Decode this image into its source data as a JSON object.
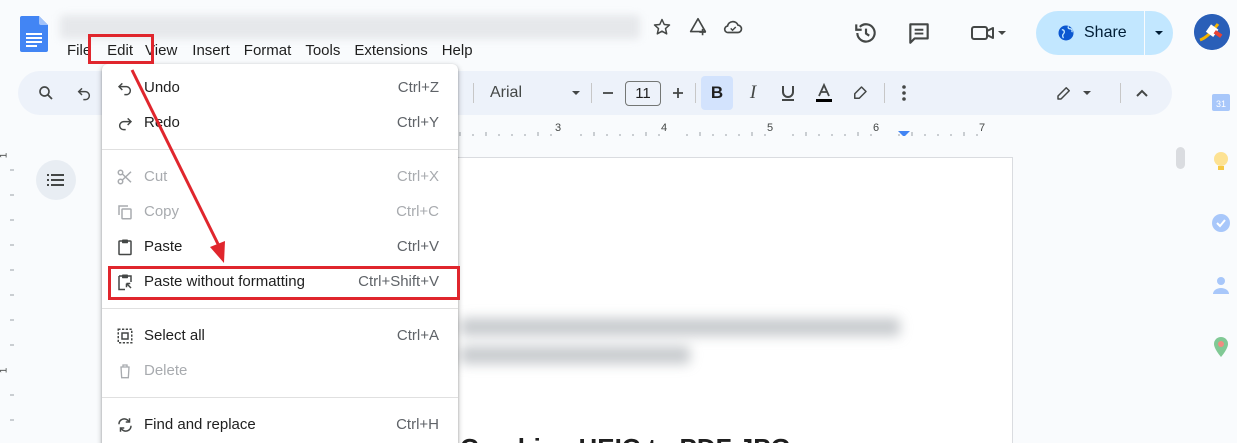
{
  "menubar": [
    "File",
    "Edit",
    "View",
    "Insert",
    "Format",
    "Tools",
    "Extensions",
    "Help"
  ],
  "share": {
    "label": "Share"
  },
  "toolbar": {
    "font_family": "Arial",
    "font_size": "11"
  },
  "ruler": {
    "h_ticks": [
      "3",
      "4",
      "5",
      "6",
      "7"
    ],
    "v_ticks": [
      "1",
      "1"
    ]
  },
  "edit_menu": {
    "items": [
      {
        "label": "Undo",
        "shortcut": "Ctrl+Z",
        "icon": "undo-icon",
        "enabled": true
      },
      {
        "label": "Redo",
        "shortcut": "Ctrl+Y",
        "icon": "redo-icon",
        "enabled": true
      },
      {
        "label": "Cut",
        "shortcut": "Ctrl+X",
        "icon": "cut-icon",
        "enabled": false
      },
      {
        "label": "Copy",
        "shortcut": "Ctrl+C",
        "icon": "copy-icon",
        "enabled": false
      },
      {
        "label": "Paste",
        "shortcut": "Ctrl+V",
        "icon": "paste-icon",
        "enabled": true
      },
      {
        "label": "Paste without formatting",
        "shortcut": "Ctrl+Shift+V",
        "icon": "paste-plain-icon",
        "enabled": true
      },
      {
        "label": "Select all",
        "shortcut": "Ctrl+A",
        "icon": "select-all-icon",
        "enabled": true
      },
      {
        "label": "Delete",
        "shortcut": "",
        "icon": "delete-icon",
        "enabled": false
      },
      {
        "label": "Find and replace",
        "shortcut": "Ctrl+H",
        "icon": "find-replace-icon",
        "enabled": true
      }
    ]
  },
  "document": {
    "heading_partial": "Combine HEIC to PDF JPG"
  },
  "colors": {
    "annotation": "#e0262d",
    "share_bg": "#c2e7ff",
    "toolbar_bg": "#edf2fa",
    "active_bold": "#d3e3fd"
  }
}
